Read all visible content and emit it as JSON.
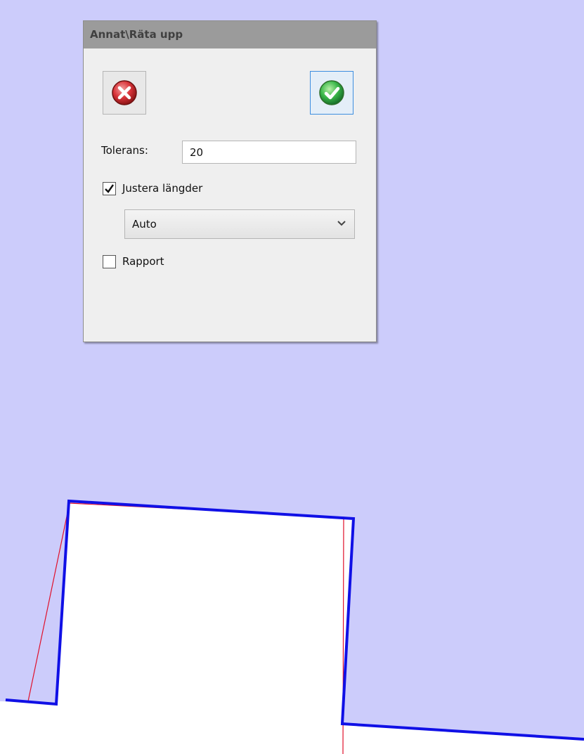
{
  "dialog": {
    "title": "Annat\\Räta upp",
    "cancel_icon": "cancel-x-icon",
    "ok_icon": "ok-check-icon",
    "tolerance_label": "Tolerans:",
    "tolerance_value": "20",
    "adjust_lengths_label": "Justera längder",
    "adjust_lengths_checked": true,
    "adjust_mode_selected": "Auto",
    "report_label": "Rapport",
    "report_checked": false
  },
  "colors": {
    "map_background": "#ccccfb",
    "parcel_fill": "#ffffff",
    "outline_blue": "#1010e6",
    "outline_red": "#e0102a",
    "cancel_red": "#d9343a",
    "ok_green": "#3bb84a"
  }
}
